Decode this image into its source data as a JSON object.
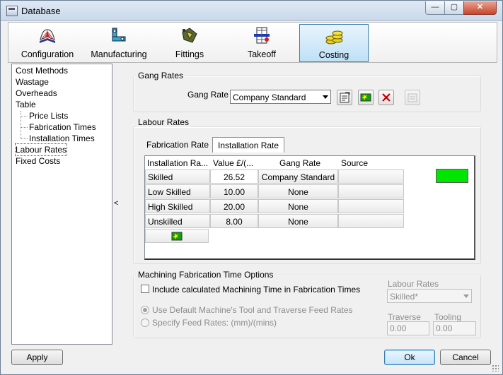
{
  "window": {
    "title": "Database"
  },
  "toolbar": {
    "items": [
      {
        "label": "Configuration",
        "icon": "books-icon"
      },
      {
        "label": "Manufacturing",
        "icon": "manufacturing-icon"
      },
      {
        "label": "Fittings",
        "icon": "fittings-icon"
      },
      {
        "label": "Takeoff",
        "icon": "takeoff-icon"
      },
      {
        "label": "Costing",
        "icon": "coins-icon",
        "active": true
      }
    ]
  },
  "tree": {
    "items": [
      {
        "label": "Cost Methods"
      },
      {
        "label": "Wastage"
      },
      {
        "label": "Overheads"
      },
      {
        "label": "Table"
      },
      {
        "label": "Price Lists"
      },
      {
        "label": "Fabrication Times"
      },
      {
        "label": "Installation Times"
      },
      {
        "label": "Labour Rates",
        "selected": true
      },
      {
        "label": "Fixed Costs"
      }
    ],
    "splitter_glyph": "<"
  },
  "gang_rates": {
    "group_title": "Gang Rates",
    "label": "Gang Rate",
    "selected": "Company Standard"
  },
  "labour_rates": {
    "group_title": "Labour Rates",
    "tabs": [
      {
        "label": "Fabrication Rate"
      },
      {
        "label": "Installation Rate",
        "active": true
      }
    ],
    "columns": [
      "Installation Ra...",
      "Value £/(...",
      "Gang Rate",
      "Source"
    ],
    "rows": [
      {
        "name": "Skilled",
        "value": "26.52",
        "gang": "Company Standard",
        "source": ""
      },
      {
        "name": "Low Skilled",
        "value": "10.00",
        "gang": "None",
        "source": ""
      },
      {
        "name": "High Skilled",
        "value": "20.00",
        "gang": "None",
        "source": ""
      },
      {
        "name": "Unskilled",
        "value": "8.00",
        "gang": "None",
        "source": ""
      }
    ],
    "swatch_color": "#00e600"
  },
  "machining": {
    "group_title": "Machining Fabrication Time Options",
    "include_label": "Include calculated Machining Time in Fabrication Times",
    "include_checked": false,
    "radio_default": "Use Default Machine's Tool and Traverse Feed Rates",
    "radio_specify": "Specify Feed Rates: (mm)/(mins)",
    "labour_rates_label": "Labour Rates",
    "labour_rates_value": "Skilled*",
    "traverse_label": "Traverse",
    "traverse_value": "0.00",
    "tooling_label": "Tooling",
    "tooling_value": "0.00"
  },
  "buttons": {
    "apply": "Apply",
    "ok": "Ok",
    "cancel": "Cancel"
  },
  "colors": {
    "accent": "#3c7fb1",
    "swatch": "#00e600",
    "delete": "#c00000"
  }
}
